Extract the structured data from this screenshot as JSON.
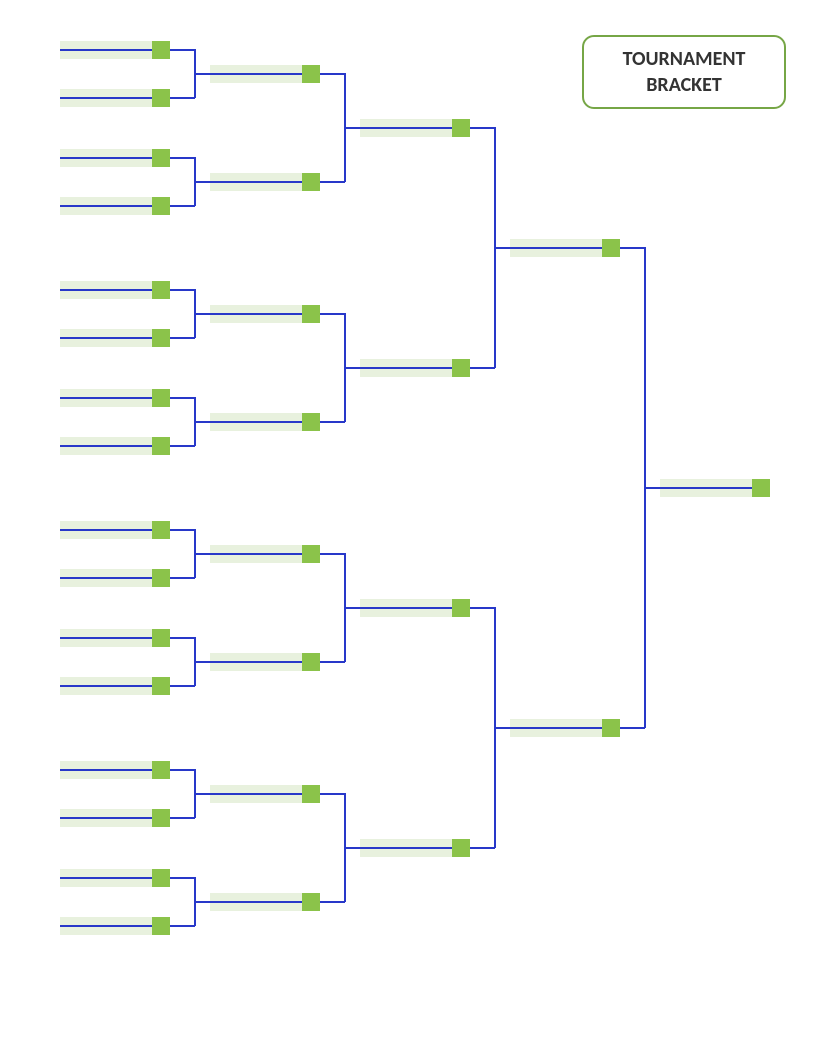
{
  "title": {
    "line1": "TOURNAMENT",
    "line2": "BRACKET"
  },
  "round1": [
    {
      "name": "",
      "score": ""
    },
    {
      "name": "",
      "score": ""
    },
    {
      "name": "",
      "score": ""
    },
    {
      "name": "",
      "score": ""
    },
    {
      "name": "",
      "score": ""
    },
    {
      "name": "",
      "score": ""
    },
    {
      "name": "",
      "score": ""
    },
    {
      "name": "",
      "score": ""
    },
    {
      "name": "",
      "score": ""
    },
    {
      "name": "",
      "score": ""
    },
    {
      "name": "",
      "score": ""
    },
    {
      "name": "",
      "score": ""
    },
    {
      "name": "",
      "score": ""
    },
    {
      "name": "",
      "score": ""
    },
    {
      "name": "",
      "score": ""
    },
    {
      "name": "",
      "score": ""
    }
  ],
  "round2": [
    {
      "name": "",
      "score": ""
    },
    {
      "name": "",
      "score": ""
    },
    {
      "name": "",
      "score": ""
    },
    {
      "name": "",
      "score": ""
    },
    {
      "name": "",
      "score": ""
    },
    {
      "name": "",
      "score": ""
    },
    {
      "name": "",
      "score": ""
    },
    {
      "name": "",
      "score": ""
    }
  ],
  "round3": [
    {
      "name": "",
      "score": ""
    },
    {
      "name": "",
      "score": ""
    },
    {
      "name": "",
      "score": ""
    },
    {
      "name": "",
      "score": ""
    }
  ],
  "round4": [
    {
      "name": "",
      "score": ""
    },
    {
      "name": "",
      "score": ""
    }
  ],
  "final": {
    "name": "",
    "score": ""
  }
}
